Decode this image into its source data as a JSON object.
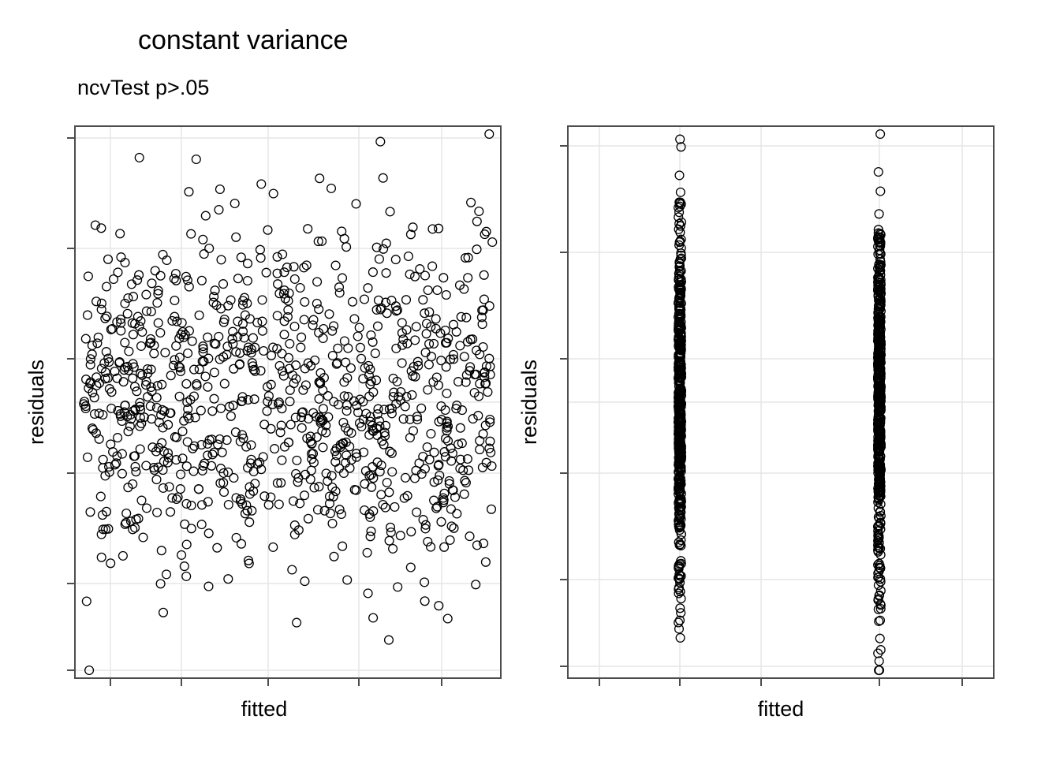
{
  "chart_data": [
    {
      "type": "scatter",
      "title": "constant variance",
      "subtitle": "ncvTest p>.05",
      "xlabel": "fitted",
      "ylabel": "residuals",
      "xlim": [
        -3.2,
        3.2
      ],
      "ylim": [
        -3.2,
        3.2
      ],
      "grid": true,
      "description": "Residuals-vs-fitted scatter, ~1000 points uniformly spread in x with roughly normal(0,1) residuals (homoscedastic cloud).",
      "series": [
        {
          "name": "residuals",
          "generator": "x ~ Uniform(-3,3), y ~ Normal(0,1), n≈1000"
        }
      ]
    },
    {
      "type": "scatter",
      "title": "",
      "subtitle": "",
      "xlabel": "fitted",
      "ylabel": "residuals",
      "xlim": [
        -0.5,
        2.5
      ],
      "ylim": [
        -3.2,
        3.2
      ],
      "grid": true,
      "description": "Residuals-vs-fitted scatter with only two fitted values (factor predictor). Two vertical stripes of residuals at x≈0.5 and x≈1.95, each roughly Normal(0,1), n≈500 each.",
      "series": [
        {
          "name": "residuals",
          "generator": "x ∈ {0.5,1.95} equal counts, y ~ Normal(0,1), n≈1000 total"
        }
      ]
    }
  ],
  "left": {
    "title": "constant variance",
    "subtitle": "ncvTest p>.05",
    "xlabel": "fitted",
    "ylabel": "residuals"
  },
  "right": {
    "xlabel": "fitted",
    "ylabel": "residuals"
  }
}
